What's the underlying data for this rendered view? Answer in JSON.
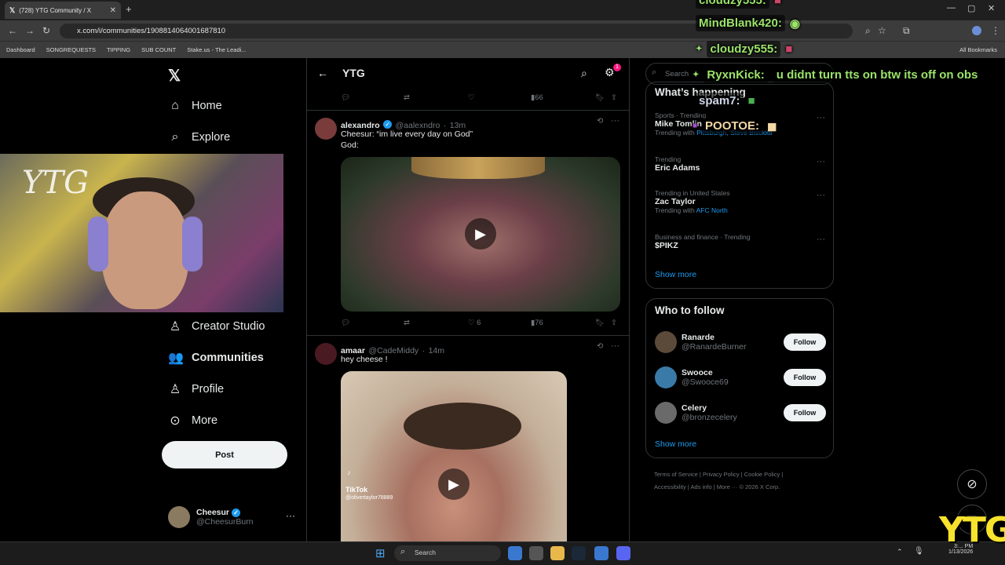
{
  "browser": {
    "tab_title": "(728) YTG Community / X",
    "url": "x.com/i/communities/1908814064001687810",
    "bookmarks": [
      "Dashboard",
      "SONGREQUESTS",
      "TIPPING",
      "SUB COUNT",
      "Stake.us - The Leadi..."
    ],
    "all_bookmarks": "All Bookmarks"
  },
  "nav": {
    "items": [
      {
        "label": "Home",
        "icon": "home-icon"
      },
      {
        "label": "Explore",
        "icon": "search-icon"
      },
      {
        "label": "Creator Studio",
        "icon": "creator-studio-icon"
      },
      {
        "label": "Communities",
        "icon": "communities-icon"
      },
      {
        "label": "Profile",
        "icon": "profile-icon"
      },
      {
        "label": "More",
        "icon": "more-circle-icon"
      }
    ],
    "post_label": "Post",
    "account": {
      "name": "Cheesur",
      "handle": "@CheesurBurn"
    }
  },
  "webcam": {
    "overlay_text": "YTG"
  },
  "feed": {
    "title": "YTG",
    "notif_count": "1",
    "top_actions": {
      "views": "66"
    },
    "posts": [
      {
        "name": "alexandro",
        "handle": "@aalexndro",
        "time": "13m",
        "text_line1": "Cheesur: “im live every day on God”",
        "text_line2": "God:",
        "likes": "6",
        "views": "76"
      },
      {
        "name": "amaar",
        "handle": "@CadeMiddy",
        "time": "14m",
        "text_line1": "hey cheese !",
        "tiktok_label": "TikTok",
        "tiktok_handle": "@olivertaylor78889"
      }
    ]
  },
  "right": {
    "search_placeholder": "Search",
    "whats_happening": "What’s happening",
    "trends": [
      {
        "meta": "Sports · Trending",
        "name": "Mike Tomlin",
        "with_label": "Trending with",
        "with": "Pittsburgh, Steve Bisciotti"
      },
      {
        "meta": "Trending",
        "name": "Eric Adams",
        "with_label": "",
        "with": ""
      },
      {
        "meta": "Trending in United States",
        "name": "Zac Taylor",
        "with_label": "Trending with",
        "with": "AFC North"
      },
      {
        "meta": "Business and finance · Trending",
        "name": "$PIKZ",
        "with_label": "",
        "with": ""
      }
    ],
    "show_more": "Show more",
    "who_to_follow": "Who to follow",
    "follow": [
      {
        "name": "Ranarde",
        "handle": "@RanardeBurner",
        "color": "#5b4a3a"
      },
      {
        "name": "Swooce",
        "handle": "@Swooce69",
        "color": "#3a7aa8"
      },
      {
        "name": "Celery",
        "handle": "@bronzecelery",
        "color": "#6a6a6a"
      }
    ],
    "follow_label": "Follow",
    "footer_line1": "Terms of Service  |  Privacy Policy  |  Cookie Policy  |",
    "footer_line2": "Accessibility  |  Ads info  |  More ···  © 2026 X Corp."
  },
  "chat": [
    {
      "user": "cloudzy555:",
      "msg": ""
    },
    {
      "user": "MindBlank420:",
      "msg": ""
    },
    {
      "user": "cloudzy555:",
      "msg": ""
    },
    {
      "user": "RyxnKick:",
      "msg": "u didnt turn tts on btw its off on obs"
    },
    {
      "user": "spam7:",
      "msg": ""
    },
    {
      "user": "POOTOE:",
      "msg": ""
    }
  ],
  "taskbar": {
    "search": "Search",
    "time": "3:... PM",
    "date": "1/13/2026"
  },
  "watermark": "YTG",
  "colors": {
    "accent": "#1d9bf0",
    "watermark": "#f7e22c",
    "chat_green": "#9be36a"
  }
}
